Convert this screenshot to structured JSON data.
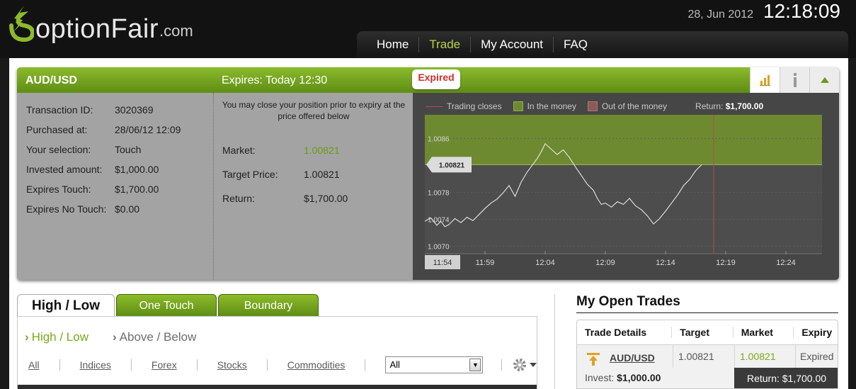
{
  "brand": {
    "name": "optionFair",
    "suffix": ".com",
    "accent": "#8cba2c"
  },
  "header": {
    "date": "28, Jun 2012",
    "time": "12:18:09"
  },
  "nav": [
    {
      "label": "Home",
      "active": false
    },
    {
      "label": "Trade",
      "active": true
    },
    {
      "label": "My Account",
      "active": false
    },
    {
      "label": "FAQ",
      "active": false
    }
  ],
  "trade": {
    "pair": "AUD/USD",
    "expires": "Expires:  Today 12:30",
    "status": "Expired",
    "tools": [
      "bar-chart-icon",
      "info-icon",
      "collapse-icon"
    ],
    "details": [
      {
        "label": "Transaction ID:",
        "value": "3020369"
      },
      {
        "label": "Purchased at:",
        "value": "28/06/12 12:09"
      },
      {
        "label": "Your selection:",
        "value": "Touch"
      },
      {
        "label": "Invested amount:",
        "value": "$1,000.00"
      },
      {
        "label": "Expires Touch:",
        "value": "$1,700.00"
      },
      {
        "label": "Expires No Touch:",
        "value": "$0.00"
      }
    ],
    "close_note": "You may close your position prior to expiry at the price offered below",
    "market_label": "Market:",
    "market_value": "1.00821",
    "target_label": "Target Price:",
    "target_value": "1.00821",
    "return_label": "Return:",
    "return_value": "$1,700.00"
  },
  "chart_data": {
    "type": "line",
    "legend": {
      "closes": "Trading closes",
      "in_money": "In the money",
      "out_money": "Out of the money",
      "return_label": "Return:",
      "return_value": "$1,700.00"
    },
    "colors": {
      "in_money": "#6e8a31",
      "out_money": "#8c5a5a",
      "closes": "#b54a4a",
      "line": "#e6e6e6"
    },
    "y_ticks": [
      "1.0070",
      "1.0074",
      "1.0078",
      "1.0086"
    ],
    "y_tick_values": [
      1.007,
      1.0074,
      1.0078,
      1.0086
    ],
    "x_ticks": [
      "11:54",
      "11:59",
      "12:04",
      "12:09",
      "12:14",
      "12:19",
      "12:24"
    ],
    "ylim": [
      1.0069,
      1.00895
    ],
    "target_label": "1.00821",
    "target_value": 1.00821,
    "closes_at": "12:18",
    "x_domain_min": [
      11,
      54
    ],
    "x_domain_max": [
      12,
      27
    ],
    "series": [
      {
        "values": [
          [
            "11:54",
            1.00737
          ],
          [
            "11:54",
            1.00742
          ],
          [
            "11:55",
            1.00731
          ],
          [
            "11:55",
            1.00737
          ],
          [
            "11:55",
            1.00729
          ],
          [
            "11:56",
            1.00732
          ],
          [
            "11:56",
            1.00741
          ],
          [
            "11:57",
            1.00735
          ],
          [
            "11:57",
            1.00743
          ],
          [
            "11:58",
            1.00738
          ],
          [
            "11:58",
            1.00747
          ],
          [
            "11:59",
            1.00756
          ],
          [
            "11:59",
            1.00764
          ],
          [
            "12:00",
            1.0077
          ],
          [
            "12:00",
            1.00779
          ],
          [
            "12:01",
            1.0079
          ],
          [
            "12:01",
            1.00774
          ],
          [
            "12:02",
            1.00795
          ],
          [
            "12:02",
            1.0081
          ],
          [
            "12:03",
            1.00822
          ],
          [
            "12:03",
            1.0083
          ],
          [
            "12:03",
            1.0084
          ],
          [
            "12:04",
            1.00852
          ],
          [
            "12:04",
            1.00844
          ],
          [
            "12:05",
            1.00836
          ],
          [
            "12:05",
            1.00843
          ],
          [
            "12:06",
            1.00832
          ],
          [
            "12:06",
            1.00818
          ],
          [
            "12:07",
            1.00805
          ],
          [
            "12:07",
            1.00792
          ],
          [
            "12:08",
            1.00783
          ],
          [
            "12:08",
            1.00771
          ],
          [
            "12:08",
            1.00762
          ],
          [
            "12:09",
            1.00764
          ],
          [
            "12:09",
            1.00758
          ],
          [
            "12:10",
            1.00766
          ],
          [
            "12:10",
            1.00762
          ],
          [
            "12:11",
            1.00771
          ],
          [
            "12:11",
            1.0076
          ],
          [
            "12:12",
            1.00754
          ],
          [
            "12:12",
            1.00745
          ],
          [
            "12:13",
            1.00733
          ],
          [
            "12:13",
            1.00741
          ],
          [
            "12:14",
            1.00752
          ],
          [
            "12:14",
            1.00764
          ],
          [
            "12:15",
            1.00776
          ],
          [
            "12:15",
            1.0079
          ],
          [
            "12:16",
            1.00799
          ],
          [
            "12:16",
            1.00812
          ],
          [
            "12:17",
            1.00821
          ]
        ]
      }
    ]
  },
  "lower": {
    "tabs": [
      {
        "label": "High / Low",
        "active": true
      },
      {
        "label": "One Touch",
        "active": false
      },
      {
        "label": "Boundary",
        "active": false
      }
    ],
    "subtabs": [
      {
        "label": "High / Low",
        "active": true
      },
      {
        "label": "Above / Below",
        "active": false
      }
    ],
    "filters": [
      "All",
      "Indices",
      "Forex",
      "Stocks",
      "Commodities"
    ],
    "select_value": "All"
  },
  "open_trades": {
    "title": "My Open Trades",
    "columns": [
      "Trade Details",
      "Target",
      "Market",
      "Expiry"
    ],
    "row": {
      "pair": "AUD/USD",
      "invest_label": "Invest:",
      "invest_value": "$1,000.00",
      "target": "1.00821",
      "market": "1.00821",
      "expiry": "Expired",
      "return_text": "Return: $1,700.00"
    }
  }
}
